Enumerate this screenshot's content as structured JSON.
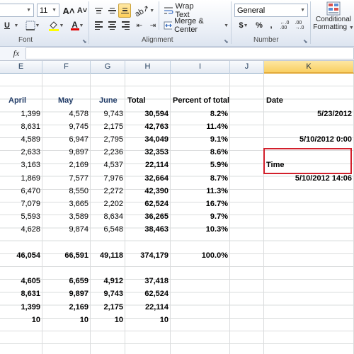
{
  "ribbon": {
    "font_size": "11",
    "grow_font": "A˄",
    "shrink_font": "A˅",
    "underline": "U",
    "font_color_letter": "A",
    "wrap_text": "Wrap Text",
    "merge_center": "Merge & Center",
    "number_format": "General",
    "currency": "$",
    "percent": "%",
    "comma": ",",
    "conditional_formatting_line1": "Conditional",
    "conditional_formatting_line2": "Formatting",
    "groups": {
      "font": "Font",
      "alignment": "Alignment",
      "number": "Number"
    },
    "colors": {
      "fill": "#ffff00",
      "font_color": "#e00000",
      "active": "#ffcf5a"
    }
  },
  "formula_bar": {
    "fx_label": "fx",
    "value": ""
  },
  "columns": [
    "E",
    "F",
    "G",
    "H",
    "I",
    "J",
    "K"
  ],
  "selected_column": "K",
  "header_row": {
    "E": "April",
    "F": "May",
    "G": "June",
    "H": "Total",
    "I": "Percent of total",
    "K": "Date"
  },
  "rows": [
    {
      "E": "1,399",
      "F": "4,578",
      "G": "9,743",
      "H": "30,594",
      "I": "8.2%",
      "K": "5/23/2012"
    },
    {
      "E": "8,631",
      "F": "9,745",
      "G": "2,175",
      "H": "42,763",
      "I": "11.4%",
      "K": ""
    },
    {
      "E": "4,589",
      "F": "6,947",
      "G": "2,795",
      "H": "34,049",
      "I": "9.1%",
      "K": "5/10/2012 0:00"
    },
    {
      "E": "2,633",
      "F": "9,897",
      "G": "2,236",
      "H": "32,353",
      "I": "8.6%",
      "K": ""
    },
    {
      "E": "3,163",
      "F": "2,169",
      "G": "4,537",
      "H": "22,114",
      "I": "5.9%",
      "K": "Time"
    },
    {
      "E": "1,869",
      "F": "7,577",
      "G": "7,976",
      "H": "32,664",
      "I": "8.7%",
      "K": "5/10/2012 14:06"
    },
    {
      "E": "6,470",
      "F": "8,550",
      "G": "2,272",
      "H": "42,390",
      "I": "11.3%",
      "K": ""
    },
    {
      "E": "7,079",
      "F": "3,665",
      "G": "2,202",
      "H": "62,524",
      "I": "16.7%",
      "K": ""
    },
    {
      "E": "5,593",
      "F": "3,589",
      "G": "8,634",
      "H": "36,265",
      "I": "9.7%",
      "K": ""
    },
    {
      "E": "4,628",
      "F": "9,874",
      "G": "6,548",
      "H": "38,463",
      "I": "10.3%",
      "K": ""
    }
  ],
  "totals_row": {
    "E": "46,054",
    "F": "66,591",
    "G": "49,118",
    "H": "374,179",
    "I": "100.0%"
  },
  "summary_rows": [
    {
      "E": "4,605",
      "F": "6,659",
      "G": "4,912",
      "H": "37,418"
    },
    {
      "E": "8,631",
      "F": "9,897",
      "G": "9,743",
      "H": "62,524"
    },
    {
      "E": "1,399",
      "F": "2,169",
      "G": "2,175",
      "H": "22,114"
    },
    {
      "E": "10",
      "F": "10",
      "G": "10",
      "H": "10"
    }
  ]
}
